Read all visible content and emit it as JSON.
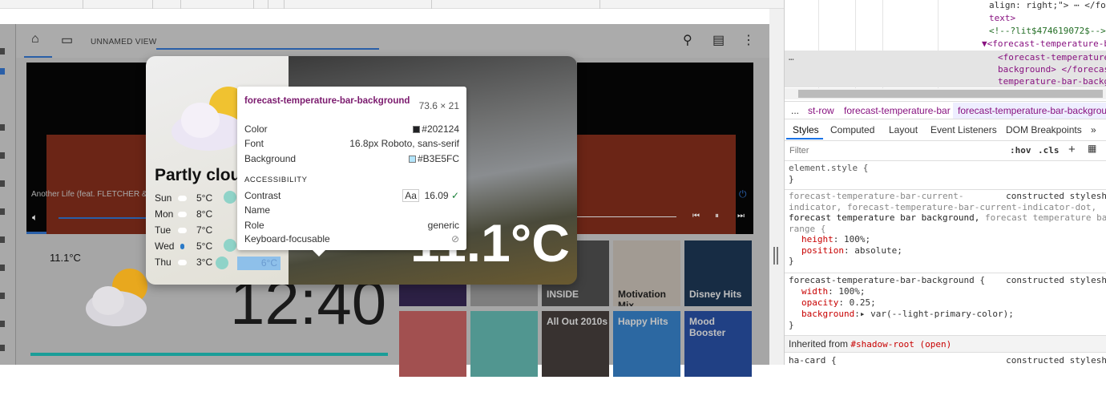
{
  "app": {
    "view_name": "UNNAMED VIEW",
    "header_icons": [
      "home-icon",
      "devices-icon",
      "search-icon",
      "assist-icon",
      "more-vert-icon"
    ],
    "media_player": {
      "song_title": "Another Life (feat. FLETCHER & ..."
    },
    "weather": {
      "current_temp": "11.1°C",
      "condition": "Partly clou",
      "big_temp": "11.1°C",
      "forecast": [
        {
          "day": "Sun",
          "icon": "cloud-icon",
          "temp": "5°C"
        },
        {
          "day": "Mon",
          "icon": "cloud-icon",
          "temp": "8°C"
        },
        {
          "day": "Tue",
          "icon": "cloud-icon",
          "temp": "7°C"
        },
        {
          "day": "Wed",
          "icon": "rain-drop-icon",
          "temp": "5°C"
        },
        {
          "day": "Thu",
          "icon": "cloud-icon",
          "temp": "3°C",
          "high": "6°C"
        }
      ]
    },
    "clock": "12:40",
    "playlists": [
      {
        "label": "",
        "color": "#3a2a5a"
      },
      {
        "label": "",
        "color": "#a8a8a8"
      },
      {
        "label": "INSIDE",
        "color": "#555"
      },
      {
        "label": "Motivation Mix",
        "color": "#d8cfc4"
      },
      {
        "label": "Disney Hits",
        "color": "#1e3a5a"
      },
      {
        "label": "",
        "color": "#d86a6a"
      },
      {
        "label": "",
        "color": "#6cc8c0"
      },
      {
        "label": "All Out 2010s",
        "color": "#4a4340"
      },
      {
        "label": "Happy Hits",
        "color": "#3a8ad8"
      },
      {
        "label": "Mood Booster",
        "color": "#2a55b0"
      }
    ]
  },
  "tooltip": {
    "element": "forecast-temperature-bar-background",
    "size": "73.6 × 21",
    "color_label": "Color",
    "color_value": "#202124",
    "font_label": "Font",
    "font_value": "16.8px Roboto, sans-serif",
    "background_label": "Background",
    "background_value": "#B3E5FC",
    "accessibility_heading": "ACCESSIBILITY",
    "contrast_label": "Contrast",
    "contrast_badge": "Aa",
    "contrast_value": "16.09",
    "name_label": "Name",
    "role_label": "Role",
    "role_value": "generic",
    "focusable_label": "Keyboard-focusable"
  },
  "devtools": {
    "dom_lines": [
      "align: right;\"> ⋯ </fore",
      "text>",
      "<!--?lit$474619072$-->",
      "▼<forecast-temperature-ba",
      "<forecast-temperature-",
      "background> </forecast",
      "temperature-bar-backgr"
    ],
    "breadcrumbs": [
      "...",
      "st-row",
      "forecast-temperature-bar",
      "forecast-temperature-bar-backgroun"
    ],
    "tabs": [
      "Styles",
      "Computed",
      "Layout",
      "Event Listeners",
      "DOM Breakpoints",
      "»"
    ],
    "filter_placeholder": "Filter",
    "hov": ":hov",
    "cls": ".cls",
    "plus": "+",
    "rules": {
      "element_style": "element.style {",
      "close": "}",
      "r1_sel_a": "forecast-temperature-bar-current-",
      "r1_sel_b": "indicator, forecast-temperature-bar-current-indicator-dot,",
      "r1_sel_c": "forecast temperature bar background,",
      "r1_sel_d": " forecast temperature bar",
      "r1_sel_e": "range {",
      "r1_p1": "height",
      "r1_v1": "100%;",
      "r1_p2": "position",
      "r1_v2": "absolute;",
      "r2_sel": "forecast-temperature-bar-background {",
      "r2_p1": "width",
      "r2_v1": "100%;",
      "r2_p2": "opacity",
      "r2_v2": "0.25;",
      "r2_p3": "background",
      "r2_v3": "▸ var(--light-primary-color);",
      "source": "constructed stylesh",
      "inherited_label": "Inherited from",
      "inherited_from": "#shadow-root (open)",
      "r3_sel": "ha-card {"
    }
  }
}
